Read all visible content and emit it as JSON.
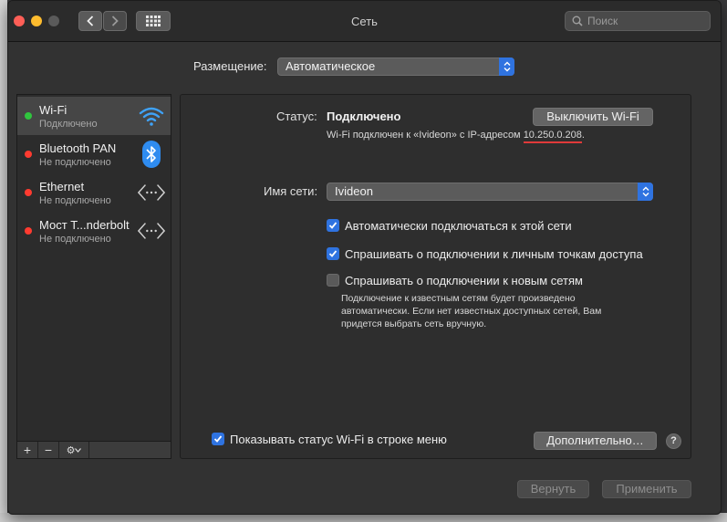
{
  "window": {
    "title": "Сеть"
  },
  "search": {
    "placeholder": "Поиск"
  },
  "location": {
    "label": "Размещение:",
    "value": "Автоматическое"
  },
  "sidebar": {
    "services": [
      {
        "name": "Wi-Fi",
        "status": "Подключено",
        "status_color": "#30c53e",
        "icon": "wifi-icon"
      },
      {
        "name": "Bluetooth PAN",
        "status": "Не подключено",
        "status_color": "#ff3b30",
        "icon": "bluetooth-icon"
      },
      {
        "name": "Ethernet",
        "status": "Не подключено",
        "status_color": "#ff3b30",
        "icon": "ethernet-icon"
      },
      {
        "name": "Мост T...nderbolt",
        "status": "Не подключено",
        "status_color": "#ff3b30",
        "icon": "thunderbolt-bridge-icon"
      }
    ],
    "toolbar": {
      "add": "+",
      "remove": "−",
      "actions": "⚙"
    }
  },
  "detail": {
    "status_label": "Статус:",
    "status_value": "Подключено",
    "turn_off_button": "Выключить Wi-Fi",
    "connection_text": "Wi-Fi подключен к «Ivideon» с IP-адресом",
    "ip_address": "10.250.0.208",
    "network_name_label": "Имя сети:",
    "network_name_value": "Ivideon",
    "checkboxes": [
      {
        "label": "Автоматически подключаться к этой сети",
        "checked": true
      },
      {
        "label": "Спрашивать о подключении к личным точкам доступа",
        "checked": true
      },
      {
        "label": "Спрашивать о подключении к новым сетям",
        "checked": false
      }
    ],
    "hint": "Подключение к известным сетям будет произведено автоматически. Если нет известных доступных сетей, Вам придется выбрать сеть вручную.",
    "show_status_checkbox": {
      "label": "Показывать статус Wi-Fi в строке меню",
      "checked": true
    },
    "advanced_button": "Дополнительно…",
    "help_button": "?"
  },
  "footer": {
    "revert_button": "Вернуть",
    "apply_button": "Применить"
  },
  "colors": {
    "accent": "#2f73e0",
    "connected": "#30c53e",
    "disconnected": "#ff3b30",
    "annotation": "#e03a3a"
  }
}
